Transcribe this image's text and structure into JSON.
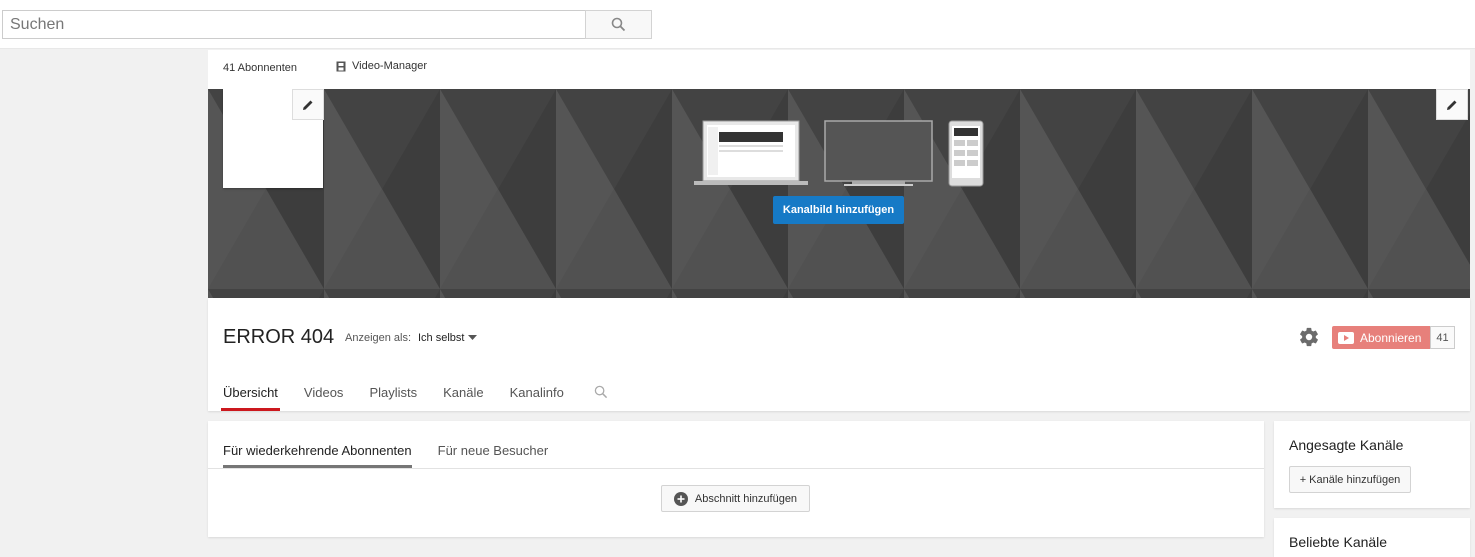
{
  "search": {
    "placeholder": "Suchen",
    "value": ""
  },
  "channel_header": {
    "subscribers_label": "41 Abonnenten",
    "video_manager_label": "Video-Manager"
  },
  "banner": {
    "add_art_label": "Kanalbild hinzufügen"
  },
  "channel": {
    "name": "ERROR 404",
    "view_as_label": "Anzeigen als:",
    "view_as_value": "Ich selbst",
    "subscribe_label": "Abonnieren",
    "subscribe_count": "41"
  },
  "tabs": [
    {
      "label": "Übersicht",
      "active": true
    },
    {
      "label": "Videos",
      "active": false
    },
    {
      "label": "Playlists",
      "active": false
    },
    {
      "label": "Kanäle",
      "active": false
    },
    {
      "label": "Kanalinfo",
      "active": false
    }
  ],
  "content": {
    "subtabs": [
      {
        "label": "Für wiederkehrende Abonnenten",
        "active": true
      },
      {
        "label": "Für neue Besucher",
        "active": false
      }
    ],
    "add_section_label": "Abschnitt hinzufügen"
  },
  "sidebar": {
    "featured_title": "Angesagte Kanäle",
    "add_channels_label": "+ Kanäle hinzufügen",
    "popular_title": "Beliebte Kanäle"
  },
  "colors": {
    "subscribe_bg": "#e7807b",
    "accent_blue": "#167ac6",
    "active_tab_red": "#cc181e"
  }
}
